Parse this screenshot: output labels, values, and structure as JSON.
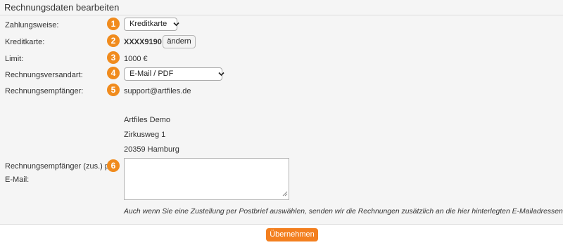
{
  "title": "Rechnungsdaten bearbeiten",
  "fields": {
    "payment_method": {
      "label": "Zahlungsweise:",
      "badge": "1",
      "selected": "Kreditkarte"
    },
    "credit_card": {
      "label": "Kreditkarte:",
      "badge": "2",
      "number": "XXXX9190",
      "change_label": "ändern"
    },
    "limit": {
      "label": "Limit:",
      "badge": "3",
      "value": "1000 €"
    },
    "shipping_method": {
      "label": "Rechnungsversandart:",
      "badge": "4",
      "selected": "E-Mail / PDF"
    },
    "recipient": {
      "label": "Rechnungsempfänger:",
      "badge": "5",
      "email": "support@artfiles.de",
      "address": [
        "Artfiles Demo",
        "Zirkusweg 1",
        "20359 Hamburg"
      ]
    },
    "extra_recipient": {
      "label_line1": "Rechnungsempfänger (zus.) per",
      "label_line2": "E-Mail:",
      "badge": "6",
      "value": ""
    }
  },
  "hint": "Auch wenn Sie eine Zustellung per Postbrief auswählen, senden wir die Rechnungen zusätzlich an die hier hinterlegten E-Mailadressen.",
  "submit_label": "Übernehmen",
  "colors": {
    "accent": "#f37f1f",
    "badge": "#f08b1d",
    "panel": "#f5f5f5"
  }
}
